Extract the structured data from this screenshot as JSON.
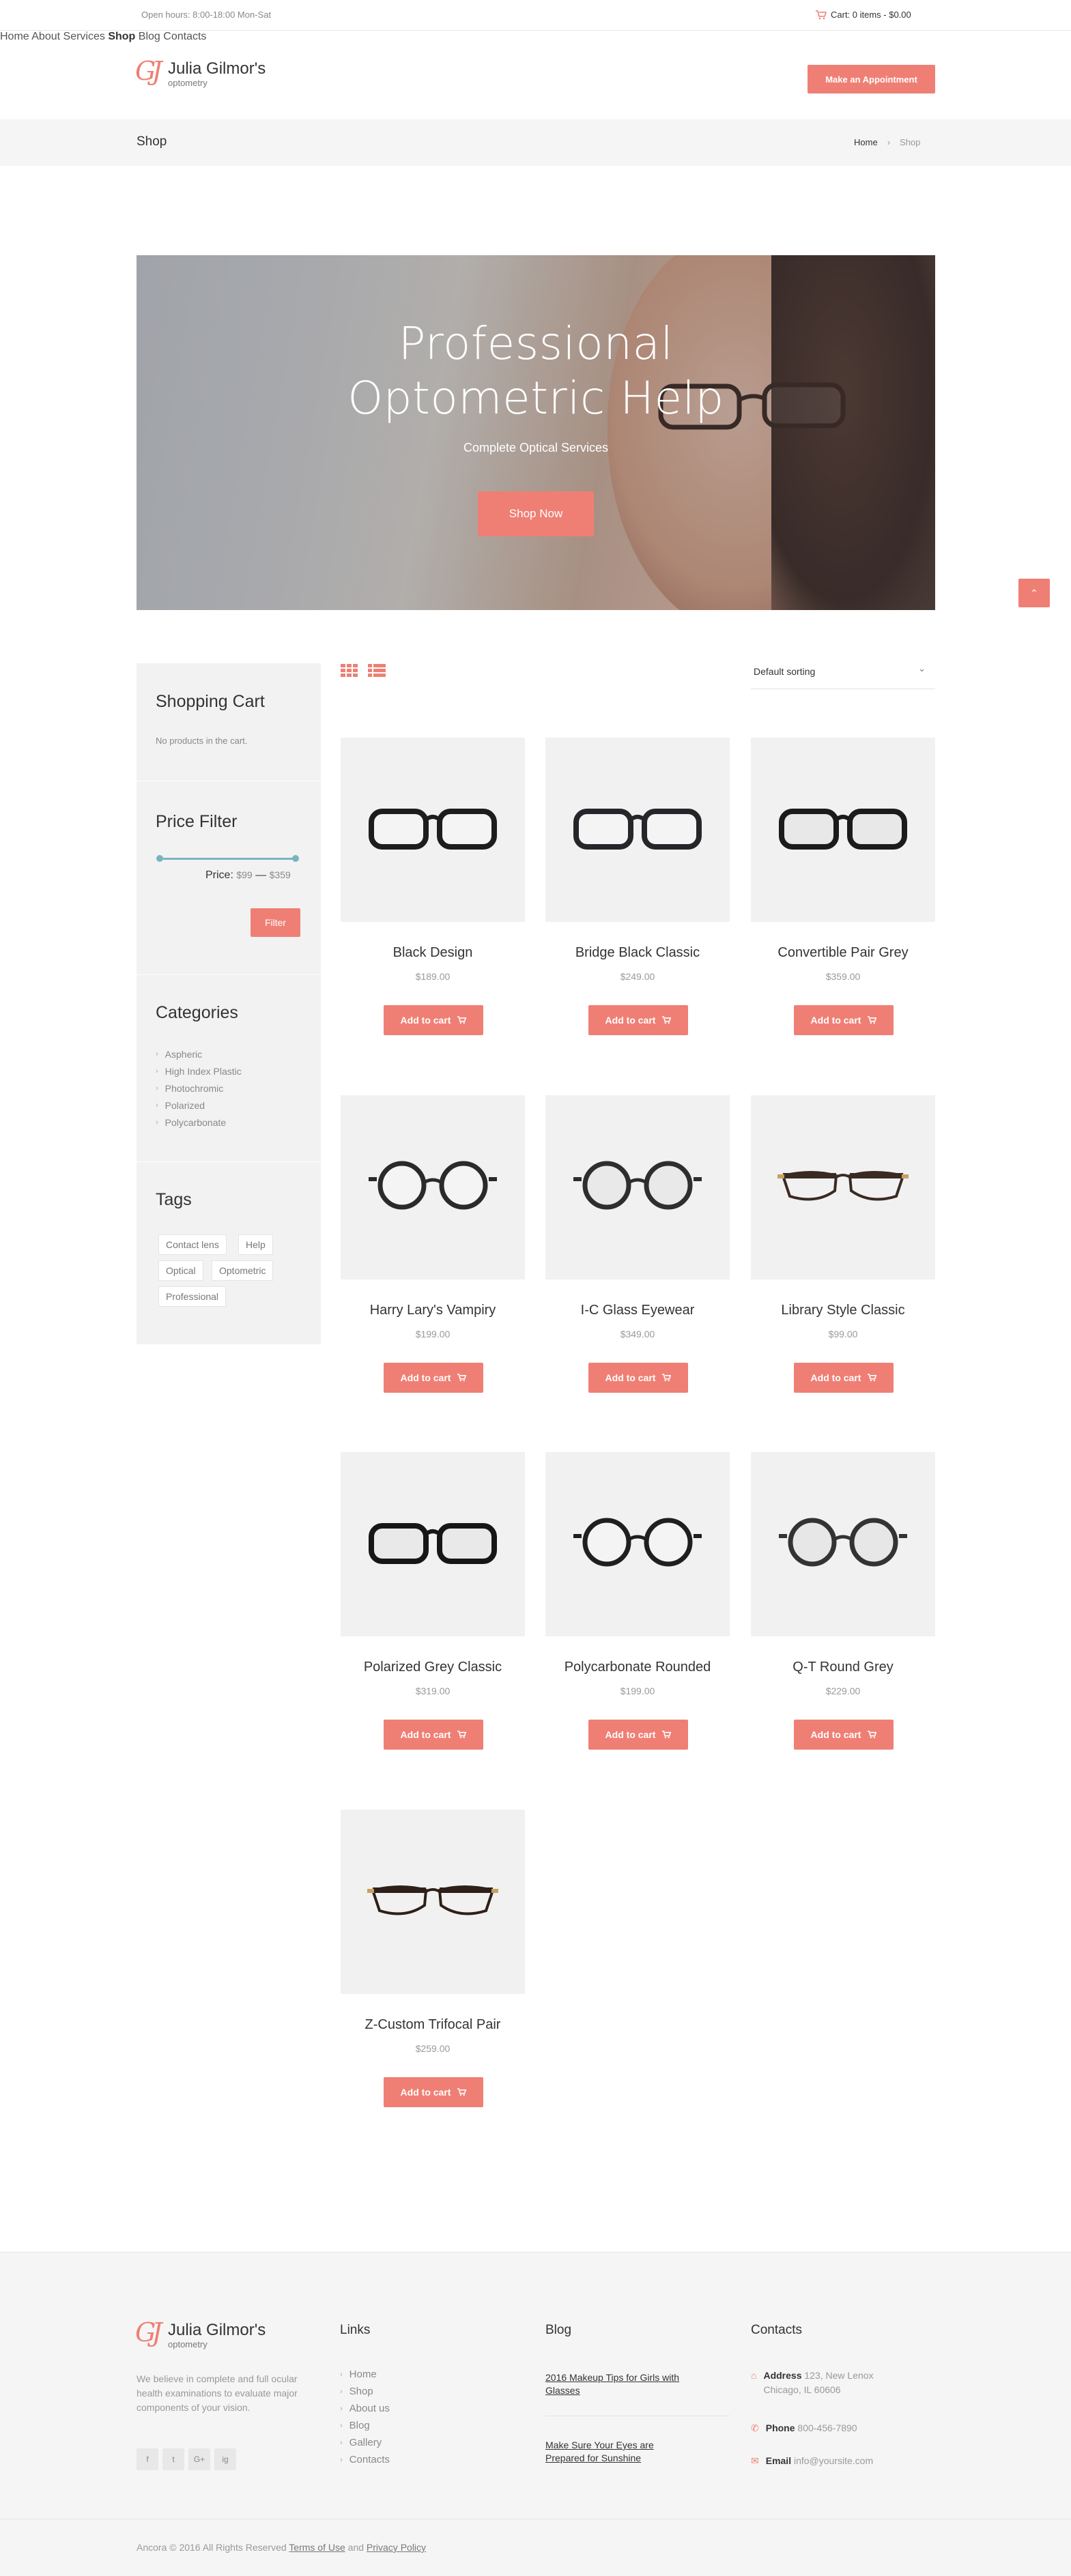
{
  "topbar": {
    "hours": "Open hours: 8:00-18:00 Mon-Sat",
    "cart": "Cart: 0 items - $0.00",
    "cart_icon": "cart-icon"
  },
  "brand": {
    "mark": "GJ",
    "name": "Julia Gilmor's",
    "sub": "optometry"
  },
  "nav": {
    "items": [
      "Home",
      "About",
      "Services",
      "Shop",
      "Blog",
      "Contacts"
    ],
    "active": "Shop",
    "appointment": "Make an Appointment"
  },
  "titlebar": {
    "title": "Shop",
    "crumbs": [
      "Home",
      "Shop"
    ]
  },
  "hero": {
    "title_line1": "Professional",
    "title_line2": "Optometric Help",
    "subtitle": "Complete Optical Services",
    "button": "Shop Now"
  },
  "sidebar": {
    "cart_title": "Shopping Cart",
    "cart_empty": "No products in the cart.",
    "price_title": "Price Filter",
    "price_label": "Price:",
    "price_min": "$99",
    "price_sep": "—",
    "price_max": "$359",
    "filter_button": "Filter",
    "categories_title": "Categories",
    "categories": [
      "Aspheric",
      "High Index Plastic",
      "Photochromic",
      "Polarized",
      "Polycarbonate"
    ],
    "tags_title": "Tags",
    "tags": [
      "Contact lens",
      "Help",
      "Optical",
      "Optometric",
      "Professional"
    ]
  },
  "toolbar": {
    "sort": "Default sorting"
  },
  "add_to_cart": "Add to cart",
  "products": [
    {
      "name": "Black Design",
      "price": "$189.00"
    },
    {
      "name": "Bridge Black Classic",
      "price": "$249.00"
    },
    {
      "name": "Convertible Pair Grey",
      "price": "$359.00"
    },
    {
      "name": "Harry Lary's Vampiry",
      "price": "$199.00"
    },
    {
      "name": "I-C Glass Eyewear",
      "price": "$349.00"
    },
    {
      "name": "Library Style Classic",
      "price": "$99.00"
    },
    {
      "name": "Polarized Grey Classic",
      "price": "$319.00"
    },
    {
      "name": "Polycarbonate Rounded",
      "price": "$199.00"
    },
    {
      "name": "Q-T Round Grey",
      "price": "$229.00"
    },
    {
      "name": "Z-Custom Trifocal Pair",
      "price": "$259.00"
    }
  ],
  "footer": {
    "about": "We believe in complete and full ocular health examinations to evaluate major components of your vision.",
    "social": [
      "f",
      "t",
      "G+",
      "ig"
    ],
    "links_title": "Links",
    "links": [
      "Home",
      "Shop",
      "About us",
      "Blog",
      "Gallery",
      "Contacts"
    ],
    "blog_title": "Blog",
    "blog": [
      "2016 Makeup Tips for Girls with Glasses",
      "Make Sure Your Eyes are Prepared for Sunshine"
    ],
    "contacts_title": "Contacts",
    "address_label": "Address",
    "address": "123, New Lenox Chicago, IL 60606",
    "phone_label": "Phone",
    "phone": "800-456-7890",
    "email_label": "Email",
    "email": "info@yoursite.com",
    "copyright": "Ancora © 2016 All Rights Reserved",
    "terms": "Terms of Use",
    "and": "and",
    "privacy": "Privacy Policy"
  },
  "colors": {
    "accent": "#ef7f74",
    "slider": "#79b4bf"
  }
}
